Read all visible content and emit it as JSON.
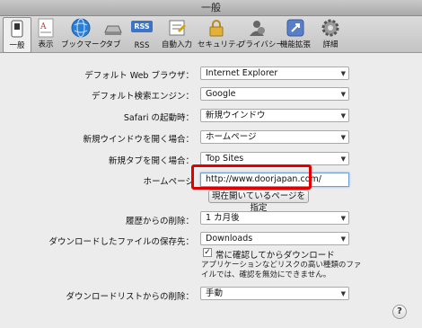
{
  "window": {
    "title": "一般"
  },
  "toolbar": {
    "items": [
      {
        "label": "一般",
        "icon": "switch-icon"
      },
      {
        "label": "表示",
        "icon": "font-icon"
      },
      {
        "label": "ブックマーク",
        "icon": "globe-icon"
      },
      {
        "label": "タブ",
        "icon": "tabs-icon"
      },
      {
        "label": "RSS",
        "icon": "rss-icon"
      },
      {
        "label": "自動入力",
        "icon": "autofill-icon"
      },
      {
        "label": "セキュリティ",
        "icon": "lock-icon"
      },
      {
        "label": "プライバシー",
        "icon": "privacy-icon"
      },
      {
        "label": "機能拡張",
        "icon": "extensions-icon"
      },
      {
        "label": "詳細",
        "icon": "gear-icon"
      }
    ],
    "rss_text": "RSS"
  },
  "settings": {
    "default_browser": {
      "label": "デフォルト Web ブラウザ：",
      "value": "Internet Explorer"
    },
    "search_engine": {
      "label": "デフォルト検索エンジン：",
      "value": "Google"
    },
    "safari_opens": {
      "label": "Safari の起動時：",
      "value": "新規ウインドウ"
    },
    "new_windows": {
      "label": "新規ウインドウを開く場合：",
      "value": "ホームページ"
    },
    "new_tabs": {
      "label": "新規タブを開く場合：",
      "value": "Top Sites"
    },
    "homepage": {
      "label": "ホームページ",
      "value": "http://www.doorjapan.com/",
      "button": "現在開いているページを指定"
    },
    "history": {
      "label": "履歴からの削除：",
      "value": "1 カ月後"
    },
    "download_location": {
      "label": "ダウンロードしたファイルの保存先：",
      "value": "Downloads"
    },
    "ask_before_download": {
      "label": "常に確認してからダウンロード",
      "checked": true,
      "note": "アプリケーションなどリスクの高い種類のファイルでは、確認を無効にできません。"
    },
    "download_list": {
      "label": "ダウンロードリストからの削除：",
      "value": "手動"
    }
  },
  "help": {
    "label": "?"
  },
  "colors": {
    "highlight": "#e00000",
    "focus": "#6f9ed8"
  }
}
